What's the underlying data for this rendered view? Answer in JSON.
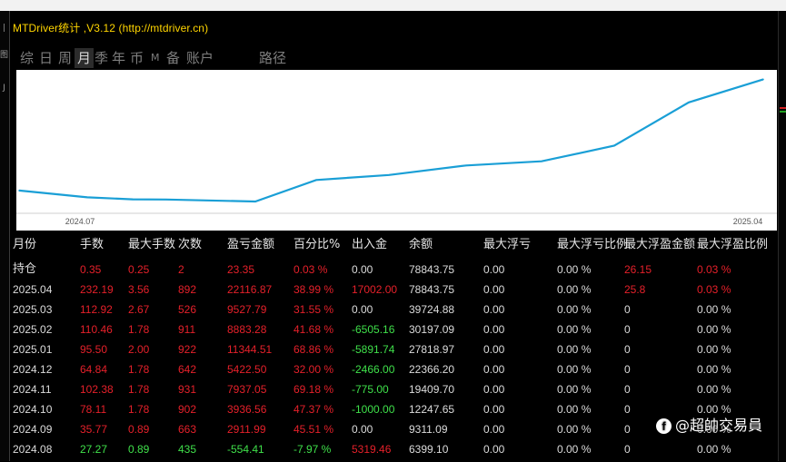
{
  "title": "MTDriver统计 ,V3.12 (http://mtdriver.cn)",
  "tabs": [
    {
      "label": "综",
      "active": false
    },
    {
      "label": "日",
      "active": false
    },
    {
      "label": "周",
      "active": false
    },
    {
      "label": "月",
      "active": true
    },
    {
      "label": "季",
      "active": false
    },
    {
      "label": "年",
      "active": false
    },
    {
      "label": "币",
      "active": false
    },
    {
      "label": "M",
      "active": false
    },
    {
      "label": "备",
      "active": false
    },
    {
      "label": "账户",
      "active": false
    },
    {
      "label": "路径",
      "active": false
    }
  ],
  "left_strip_marks": [
    "|",
    "图",
    "J"
  ],
  "chart_data": {
    "type": "line",
    "x_tick_labels": [
      "2024.07",
      "2025.04"
    ],
    "line_color": "#1a9fd6",
    "x": [
      "2024.06",
      "2024.07",
      "2024.08",
      "2024.09",
      "2024.10",
      "2024.11",
      "2024.12",
      "2025.01",
      "2025.02",
      "2025.03",
      "2025.04",
      "2025.05"
    ],
    "values": [
      13.1,
      9.0,
      7.8,
      7.7,
      6.5,
      19.4,
      22.4,
      28.1,
      30.6,
      39.9,
      65.8,
      79.6
    ],
    "grid": false
  },
  "table": {
    "headers": [
      "月份",
      "手数",
      "最大手数",
      "次数",
      "盈亏金额",
      "百分比%",
      "出入金",
      "余额",
      "最大浮亏",
      "最大浮亏比例",
      "最大浮盈金额",
      "最大浮盈比例"
    ],
    "rows": [
      {
        "cells": [
          "持仓",
          "0.35",
          "0.25",
          "2",
          "23.35",
          "0.03 %",
          "0.00",
          "78843.75",
          "0.00",
          "0.00 %",
          "26.15",
          "0.03 %"
        ],
        "colors": [
          "white",
          "red",
          "red",
          "red",
          "red",
          "red",
          "white",
          "white",
          "white",
          "white",
          "red",
          "red"
        ]
      },
      {
        "cells": [
          "2025.04",
          "232.19",
          "3.56",
          "892",
          "22116.87",
          "38.99 %",
          "17002.00",
          "78843.75",
          "0.00",
          "0.00 %",
          "25.8",
          "0.03 %"
        ],
        "colors": [
          "white",
          "red",
          "red",
          "red",
          "red",
          "red",
          "red",
          "white",
          "white",
          "white",
          "red",
          "red"
        ]
      },
      {
        "cells": [
          "2025.03",
          "112.92",
          "2.67",
          "526",
          "9527.79",
          "31.55 %",
          "0.00",
          "39724.88",
          "0.00",
          "0.00 %",
          "0",
          "0.00 %"
        ],
        "colors": [
          "white",
          "red",
          "red",
          "red",
          "red",
          "red",
          "white",
          "white",
          "white",
          "white",
          "white",
          "white"
        ]
      },
      {
        "cells": [
          "2025.02",
          "110.46",
          "1.78",
          "911",
          "8883.28",
          "41.68 %",
          "-6505.16",
          "30197.09",
          "0.00",
          "0.00 %",
          "0",
          "0.00 %"
        ],
        "colors": [
          "white",
          "red",
          "red",
          "red",
          "red",
          "red",
          "green",
          "white",
          "white",
          "white",
          "white",
          "white"
        ]
      },
      {
        "cells": [
          "2025.01",
          "95.50",
          "2.00",
          "922",
          "11344.51",
          "68.86 %",
          "-5891.74",
          "27818.97",
          "0.00",
          "0.00 %",
          "0",
          "0.00 %"
        ],
        "colors": [
          "white",
          "red",
          "red",
          "red",
          "red",
          "red",
          "green",
          "white",
          "white",
          "white",
          "white",
          "white"
        ]
      },
      {
        "cells": [
          "2024.12",
          "64.84",
          "1.78",
          "642",
          "5422.50",
          "32.00 %",
          "-2466.00",
          "22366.20",
          "0.00",
          "0.00 %",
          "0",
          "0.00 %"
        ],
        "colors": [
          "white",
          "red",
          "red",
          "red",
          "red",
          "red",
          "green",
          "white",
          "white",
          "white",
          "white",
          "white"
        ]
      },
      {
        "cells": [
          "2024.11",
          "102.38",
          "1.78",
          "931",
          "7937.05",
          "69.18 %",
          "-775.00",
          "19409.70",
          "0.00",
          "0.00 %",
          "0",
          "0.00 %"
        ],
        "colors": [
          "white",
          "red",
          "red",
          "red",
          "red",
          "red",
          "green",
          "white",
          "white",
          "white",
          "white",
          "white"
        ]
      },
      {
        "cells": [
          "2024.10",
          "78.11",
          "1.78",
          "902",
          "3936.56",
          "47.37 %",
          "-1000.00",
          "12247.65",
          "0.00",
          "0.00 %",
          "0",
          "0.00 %"
        ],
        "colors": [
          "white",
          "red",
          "red",
          "red",
          "red",
          "red",
          "green",
          "white",
          "white",
          "white",
          "white",
          "white"
        ]
      },
      {
        "cells": [
          "2024.09",
          "35.77",
          "0.89",
          "663",
          "2911.99",
          "45.51 %",
          "0.00",
          "9311.09",
          "0.00",
          "0.00 %",
          "0",
          "0.00 %"
        ],
        "colors": [
          "white",
          "red",
          "red",
          "red",
          "red",
          "red",
          "white",
          "white",
          "white",
          "white",
          "white",
          "white"
        ]
      },
      {
        "cells": [
          "2024.08",
          "27.27",
          "0.89",
          "435",
          "-554.41",
          "-7.97 %",
          "5319.46",
          "6399.10",
          "0.00",
          "0.00 %",
          "0",
          "0.00 %"
        ],
        "colors": [
          "white",
          "green",
          "green",
          "green",
          "green",
          "green",
          "red",
          "white",
          "white",
          "white",
          "white",
          "white"
        ]
      }
    ]
  },
  "watermark": {
    "icon": "facebook-icon",
    "text": "@超帥交易員"
  },
  "colors": {
    "accent_title": "#ffd500",
    "positive": "#e5202a",
    "negative": "#3fe04a",
    "line": "#1a9fd6"
  }
}
